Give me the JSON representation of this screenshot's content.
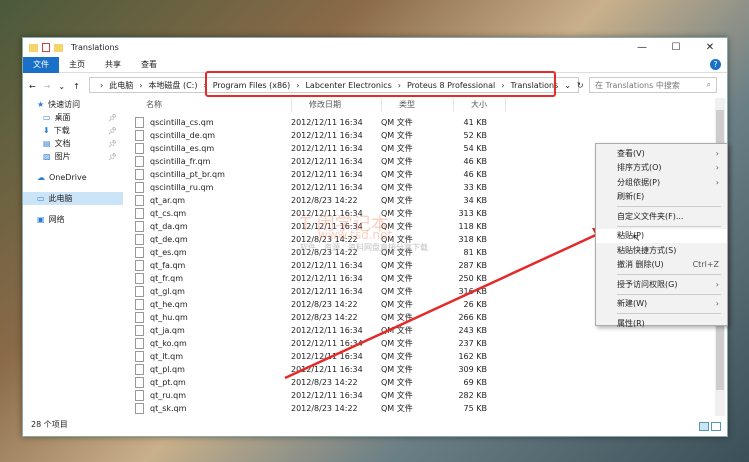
{
  "window": {
    "title": "Translations",
    "minimize": "—",
    "maximize": "☐",
    "close": "✕"
  },
  "ribbon": {
    "tabs": [
      "文件",
      "主页",
      "共享",
      "查看"
    ],
    "help": "?"
  },
  "nav": {
    "back": "←",
    "forward": "→",
    "recent": "⌄",
    "up": "↑",
    "refresh": "↻",
    "dropdown": "⌄",
    "path": [
      "此电脑",
      "本地磁盘 (C:)",
      "Program Files (x86)",
      "Labcenter Electronics",
      "Proteus 8 Professional",
      "Translations"
    ],
    "search_placeholder": "在 Translations 中搜索"
  },
  "sidebar": {
    "items": [
      {
        "label": "快速访问",
        "icon": "star-icon",
        "pinned": false
      },
      {
        "label": "桌面",
        "icon": "desktop-icon",
        "pinned": true
      },
      {
        "label": "下载",
        "icon": "download-icon",
        "pinned": true
      },
      {
        "label": "文档",
        "icon": "document-icon",
        "pinned": true
      },
      {
        "label": "图片",
        "icon": "picture-icon",
        "pinned": true
      },
      {
        "label": "OneDrive",
        "icon": "cloud-icon",
        "pinned": false
      },
      {
        "label": "此电脑",
        "icon": "computer-icon",
        "pinned": false,
        "selected": true
      },
      {
        "label": "网络",
        "icon": "network-icon",
        "pinned": false
      }
    ]
  },
  "columns": [
    "名称",
    "修改日期",
    "类型",
    "大小"
  ],
  "files": [
    [
      "qscintilla_cs.qm",
      "2012/12/11 16:34",
      "QM 文件",
      "41 KB"
    ],
    [
      "qscintilla_de.qm",
      "2012/12/11 16:34",
      "QM 文件",
      "52 KB"
    ],
    [
      "qscintilla_es.qm",
      "2012/12/11 16:34",
      "QM 文件",
      "54 KB"
    ],
    [
      "qscintilla_fr.qm",
      "2012/12/11 16:34",
      "QM 文件",
      "46 KB"
    ],
    [
      "qscintilla_pt_br.qm",
      "2012/12/11 16:34",
      "QM 文件",
      "46 KB"
    ],
    [
      "qscintilla_ru.qm",
      "2012/12/11 16:34",
      "QM 文件",
      "33 KB"
    ],
    [
      "qt_ar.qm",
      "2012/8/23 14:22",
      "QM 文件",
      "34 KB"
    ],
    [
      "qt_cs.qm",
      "2012/12/11 16:34",
      "QM 文件",
      "313 KB"
    ],
    [
      "qt_da.qm",
      "2012/12/11 16:34",
      "QM 文件",
      "118 KB"
    ],
    [
      "qt_de.qm",
      "2012/8/23 14:22",
      "QM 文件",
      "318 KB"
    ],
    [
      "qt_es.qm",
      "2012/8/23 14:22",
      "QM 文件",
      "81 KB"
    ],
    [
      "qt_fa.qm",
      "2012/12/11 16:34",
      "QM 文件",
      "287 KB"
    ],
    [
      "qt_fr.qm",
      "2012/12/11 16:34",
      "QM 文件",
      "250 KB"
    ],
    [
      "qt_gl.qm",
      "2012/12/11 16:34",
      "QM 文件",
      "316 KB"
    ],
    [
      "qt_he.qm",
      "2012/8/23 14:22",
      "QM 文件",
      "26 KB"
    ],
    [
      "qt_hu.qm",
      "2012/8/23 14:22",
      "QM 文件",
      "266 KB"
    ],
    [
      "qt_ja.qm",
      "2012/12/11 16:34",
      "QM 文件",
      "243 KB"
    ],
    [
      "qt_ko.qm",
      "2012/12/11 16:34",
      "QM 文件",
      "237 KB"
    ],
    [
      "qt_lt.qm",
      "2012/12/11 16:34",
      "QM 文件",
      "162 KB"
    ],
    [
      "qt_pl.qm",
      "2012/12/11 16:34",
      "QM 文件",
      "309 KB"
    ],
    [
      "qt_pt.qm",
      "2012/8/23 14:22",
      "QM 文件",
      "69 KB"
    ],
    [
      "qt_ru.qm",
      "2012/12/11 16:34",
      "QM 文件",
      "282 KB"
    ],
    [
      "qt_sk.qm",
      "2012/8/23 14:22",
      "QM 文件",
      "75 KB"
    ]
  ],
  "status": "28 个项目",
  "context_menu": [
    {
      "label": "查看(V)",
      "submenu": true
    },
    {
      "label": "排序方式(O)",
      "submenu": true
    },
    {
      "label": "分组依据(P)",
      "submenu": true
    },
    {
      "label": "刷新(E)"
    },
    {
      "sep": true
    },
    {
      "label": "自定义文件夹(F)..."
    },
    {
      "sep": true
    },
    {
      "label": "粘贴(P)",
      "highlighted": true
    },
    {
      "label": "粘贴快捷方式(S)"
    },
    {
      "label": "撤消 删除(U)",
      "shortcut": "Ctrl+Z"
    },
    {
      "sep": true
    },
    {
      "label": "授予访问权限(G)",
      "submenu": true
    },
    {
      "sep": true
    },
    {
      "label": "新建(W)",
      "submenu": true
    },
    {
      "sep": true
    },
    {
      "label": "属性(R)"
    }
  ],
  "watermark": {
    "title": "T 闹学记本",
    "url": "www.tsd.net",
    "tagline": "软件、资源、资料网盘直接分享下载"
  },
  "annotation_color": "#e52a2a"
}
